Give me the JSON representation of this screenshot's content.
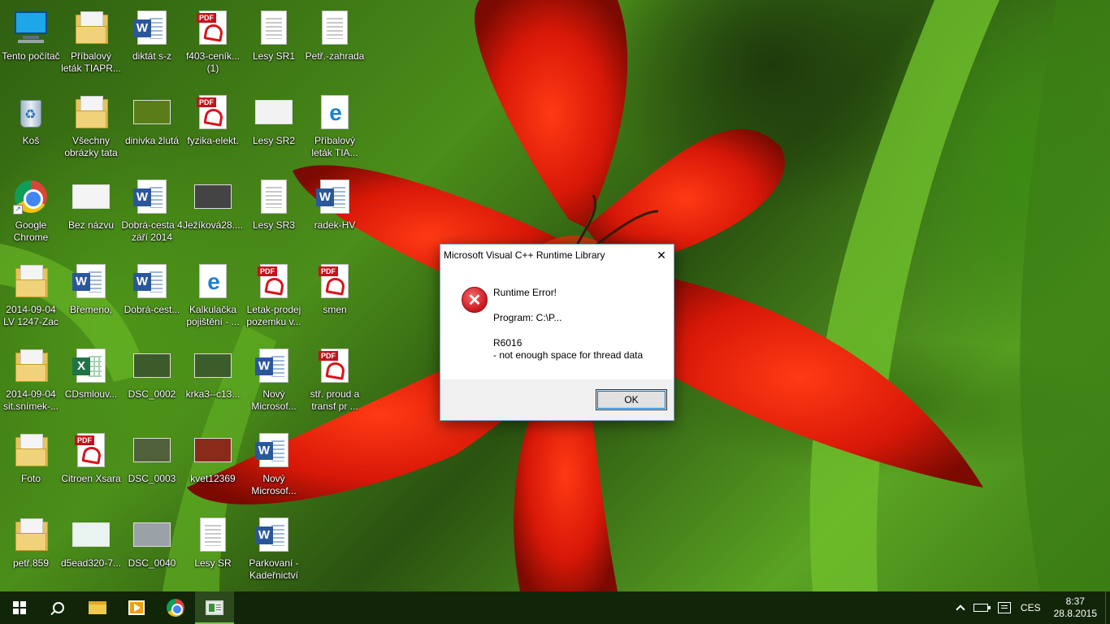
{
  "desktop": {
    "icons": [
      {
        "label": "Tento počítač",
        "kind": "pc",
        "icon_name": "computer-icon"
      },
      {
        "label": "Koš",
        "kind": "bin",
        "icon_name": "recycle-bin-icon"
      },
      {
        "label": "Google Chrome",
        "kind": "chrome",
        "icon_name": "chrome-icon"
      },
      {
        "label": "2014-09-04 LV 1247-Zac",
        "kind": "folder",
        "icon_name": "folder-icon"
      },
      {
        "label": "2014-09-04 sit.snímek-...",
        "kind": "folder",
        "icon_name": "folder-icon"
      },
      {
        "label": "Foto",
        "kind": "folder",
        "icon_name": "folder-icon"
      },
      {
        "label": "petř.859",
        "kind": "folder",
        "icon_name": "folder-icon"
      },
      {
        "label": "Příbalový leták TIAPR...",
        "kind": "folder",
        "icon_name": "folder-icon"
      },
      {
        "label": "Všechny obrázky tata",
        "kind": "folder",
        "icon_name": "folder-icon"
      },
      {
        "label": "Bez názvu",
        "kind": "photo",
        "icon_name": "image-icon",
        "color": "#f4f4f4"
      },
      {
        "label": "Břemeno,",
        "kind": "word",
        "icon_name": "word-document-icon"
      },
      {
        "label": "CDsmlouv...",
        "kind": "excel",
        "icon_name": "excel-document-icon"
      },
      {
        "label": "Citroen Xsara",
        "kind": "pdf",
        "icon_name": "pdf-document-icon"
      },
      {
        "label": "d5ead320-7...",
        "kind": "photo",
        "icon_name": "image-icon",
        "color": "#e9f3ef"
      },
      {
        "label": "diktát s-z",
        "kind": "word",
        "icon_name": "word-document-icon"
      },
      {
        "label": "dinivka žlutá",
        "kind": "photo",
        "icon_name": "image-icon",
        "color": "#5a7d1a"
      },
      {
        "label": "Dobrá-cesta 4 září 2014",
        "kind": "word",
        "icon_name": "word-document-icon"
      },
      {
        "label": "Dobrá-cest...",
        "kind": "word",
        "icon_name": "word-document-icon"
      },
      {
        "label": "DSC_0002",
        "kind": "photo",
        "icon_name": "image-icon",
        "color": "#3d5a2a"
      },
      {
        "label": "DSC_0003",
        "kind": "photo",
        "icon_name": "image-icon",
        "color": "#50603a"
      },
      {
        "label": "DSC_0040",
        "kind": "photo",
        "icon_name": "image-icon",
        "color": "#9aa2a8"
      },
      {
        "label": "f403-ceník... (1)",
        "kind": "pdf",
        "icon_name": "pdf-document-icon"
      },
      {
        "label": "fyzika-elekt.",
        "kind": "pdf",
        "icon_name": "pdf-document-icon"
      },
      {
        "label": "Ježíková28....",
        "kind": "photo",
        "icon_name": "image-icon",
        "color": "#444"
      },
      {
        "label": "Kalkulačka pojištění - ...",
        "kind": "edge",
        "icon_name": "edge-document-icon"
      },
      {
        "label": "krka3--c13...",
        "kind": "photo",
        "icon_name": "image-icon",
        "color": "#3b5d2a"
      },
      {
        "label": "kvet12369",
        "kind": "photo",
        "icon_name": "image-icon",
        "color": "#8a2a1a"
      },
      {
        "label": "Lesy SR",
        "kind": "doc",
        "icon_name": "document-icon"
      },
      {
        "label": "Lesy SR1",
        "kind": "doc",
        "icon_name": "document-icon"
      },
      {
        "label": "Lesy SR2",
        "kind": "photo",
        "icon_name": "image-icon",
        "color": "#f2f2f2"
      },
      {
        "label": "Lesy SR3",
        "kind": "doc",
        "icon_name": "document-icon"
      },
      {
        "label": "Letak-prodej pozemku v...",
        "kind": "pdf",
        "icon_name": "pdf-document-icon"
      },
      {
        "label": "Nový Microsof...",
        "kind": "word",
        "icon_name": "word-document-icon"
      },
      {
        "label": "Nový Microsof...",
        "kind": "word",
        "icon_name": "word-document-icon"
      },
      {
        "label": "Parkovaní - Kadeřnictví",
        "kind": "word",
        "icon_name": "word-document-icon"
      },
      {
        "label": "Petř.-zahrada",
        "kind": "doc",
        "icon_name": "document-icon"
      },
      {
        "label": "Příbalový leták TIA...",
        "kind": "edge",
        "icon_name": "edge-document-icon"
      },
      {
        "label": "radek-HV",
        "kind": "word",
        "icon_name": "word-document-icon"
      },
      {
        "label": "smen",
        "kind": "pdf",
        "icon_name": "pdf-document-icon"
      },
      {
        "label": "stř. proud a transf pr ...",
        "kind": "pdf",
        "icon_name": "pdf-document-icon"
      }
    ]
  },
  "dialog": {
    "title": "Microsoft Visual C++ Runtime Library",
    "close_glyph": "✕",
    "error_glyph": "✕",
    "line1": "Runtime Error!",
    "line2": "Program: C:\\P...",
    "line3": "R6016",
    "line4": "- not enough space for thread data",
    "ok_label": "OK"
  },
  "taskbar": {
    "language": "CES",
    "time": "8:37",
    "date": "28.8.2015",
    "pinned": [
      {
        "name": "file-explorer",
        "icon_name": "folder-icon"
      },
      {
        "name": "media-player",
        "icon_name": "media-player-icon"
      },
      {
        "name": "chrome",
        "icon_name": "chrome-icon"
      },
      {
        "name": "active-app",
        "icon_name": "application-icon"
      }
    ]
  },
  "colors": {
    "taskbar_bg": "#112608",
    "accent": "#7fbf4d",
    "error_red": "#c8161d"
  }
}
